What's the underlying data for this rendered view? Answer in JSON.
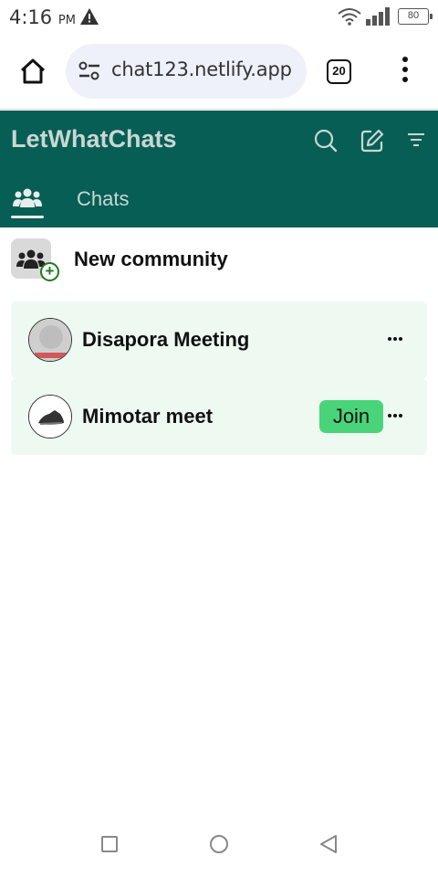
{
  "status_bar": {
    "time": "4:16",
    "ampm": "PM",
    "battery": "80",
    "icons": [
      "warning-icon",
      "wifi-icon",
      "signal-icon",
      "battery-icon"
    ]
  },
  "browser": {
    "url": "chat123.netlify.app",
    "tab_count": "20",
    "icons": [
      "home-icon",
      "site-settings-icon",
      "tab-switcher-icon",
      "overflow-menu-icon"
    ]
  },
  "app": {
    "title": "LetWhatChats",
    "header_icons": [
      "search-icon",
      "compose-icon",
      "filter-icon"
    ],
    "tabs": [
      {
        "icon": "communities-icon",
        "label": "",
        "active": true
      },
      {
        "label": "Chats",
        "active": false
      }
    ],
    "colors": {
      "header_bg": "#075e54",
      "item_bg": "#eefaf1",
      "join_bg": "#4ad47a"
    }
  },
  "new_community": {
    "label": "New community",
    "icon": "add-community-icon"
  },
  "communities": [
    {
      "name": "Disapora Meeting",
      "avatar": "default-avatar",
      "join_label": null
    },
    {
      "name": "Mimotar meet",
      "avatar": "shoe-image-avatar",
      "join_label": "Join"
    }
  ]
}
